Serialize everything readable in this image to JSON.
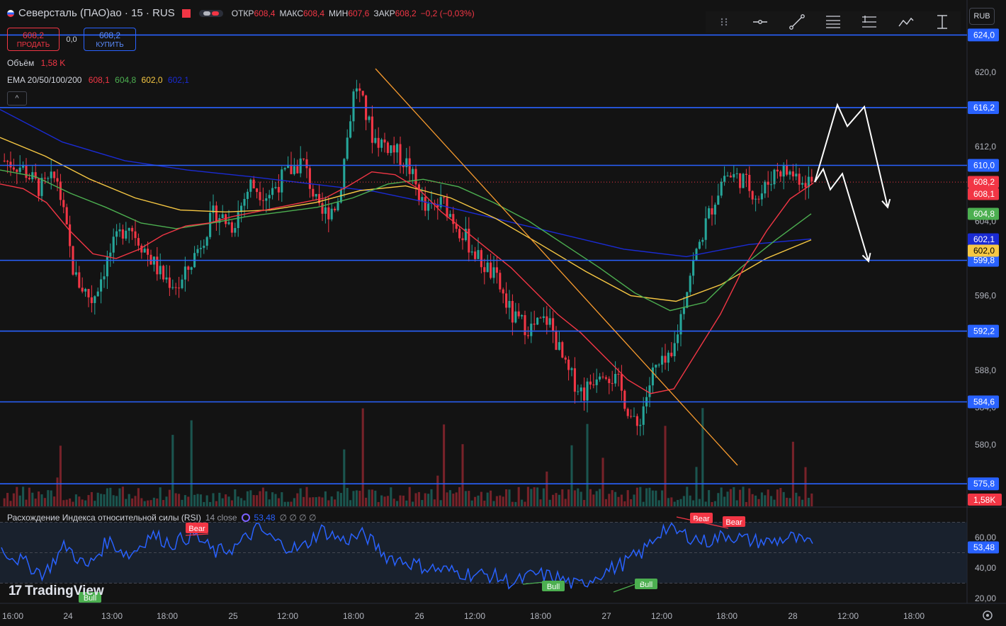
{
  "header": {
    "symbol": "Северсталь (ПАО)ао · 15 · RUS",
    "ohlc": [
      {
        "k": "ОТКР",
        "v": "608,4"
      },
      {
        "k": "МАКС",
        "v": "608,4"
      },
      {
        "k": "МИН",
        "v": "607,6"
      },
      {
        "k": "ЗАКР",
        "v": "608,2"
      },
      {
        "k": "",
        "v": "−0,2 (−0,03%)"
      }
    ]
  },
  "trade": {
    "sell_price": "608,2",
    "sell_label": "ПРОДАТЬ",
    "spread": "0,0",
    "buy_price": "608,2",
    "buy_label": "КУПИТЬ"
  },
  "volume_legend": {
    "label": "Объём",
    "value": "1,58 K"
  },
  "ema_legend": {
    "label": "EMA 20/50/100/200",
    "v20": "608,1",
    "v50": "604,8",
    "v100": "602,0",
    "v200": "602,1"
  },
  "collapse_label": "^",
  "currency": "RUB",
  "rsi_legend": {
    "label": "Расхождение Индекса относительной силы (RSI)",
    "params": "14 close",
    "value": "53,48",
    "extra": "∅ ∅ ∅ ∅"
  },
  "logo": {
    "text": "TradingView"
  },
  "colors": {
    "bull": "#26a69a",
    "bear": "#f23645",
    "ema20": "#f23645",
    "ema50": "#4caf50",
    "ema100": "#f7c843",
    "ema200": "#1a2bd4",
    "level": "#2962ff",
    "trend": "#f89b2e",
    "rsi": "#2962ff"
  },
  "chart_data": {
    "type": "candlestick",
    "x_ticks": [
      "16:00",
      "24",
      "13:00",
      "18:00",
      "25",
      "12:00",
      "18:00",
      "26",
      "12:00",
      "18:00",
      "27",
      "12:00",
      "18:00",
      "28",
      "12:00",
      "18:00"
    ],
    "y_ticks": [
      "620,0",
      "612,0",
      "596,0",
      "588,0",
      "580,0"
    ],
    "ylim": [
      575.0,
      626.0
    ],
    "horizontal_levels": [
      {
        "value": 624.0,
        "label": "624,0"
      },
      {
        "value": 616.2,
        "label": "616,2"
      },
      {
        "value": 610.0,
        "label": "610,0"
      },
      {
        "value": 599.8,
        "label": "599,8"
      },
      {
        "value": 592.2,
        "label": "592,2"
      },
      {
        "value": 584.6,
        "label": "584,6"
      },
      {
        "value": 575.8,
        "label": "575,8"
      }
    ],
    "price_labels": [
      {
        "value": 608.2,
        "label": "608,2",
        "color": "#f23645"
      },
      {
        "value": 608.1,
        "label": "608,1",
        "color": "#f23645"
      },
      {
        "value": 604.8,
        "label": "604,8",
        "color": "#4caf50"
      },
      {
        "value": 602.1,
        "label": "602,1",
        "color": "#1a2bd4"
      },
      {
        "value": 602.0,
        "label": "602,0",
        "color": "#f7c843"
      }
    ],
    "last_volume_label": "1,58K",
    "close_path": [
      610.5,
      609.8,
      607.5,
      608.7,
      598,
      595.5,
      600.5,
      604,
      601,
      598,
      597,
      601,
      605,
      603.5,
      608,
      606.8,
      609,
      610.5,
      604.5,
      606,
      619,
      613,
      612,
      610,
      605,
      606,
      603,
      600,
      597.8,
      593.5,
      592.5,
      593.5,
      588,
      585.5,
      588.5,
      586.5,
      581.5,
      588,
      589,
      598,
      604,
      609,
      608.6,
      606.5,
      609.7,
      609,
      608.2
    ],
    "ema20": [
      608,
      607.5,
      606,
      603,
      600.5,
      600,
      601,
      602.5,
      603.5,
      603.8,
      604.5,
      605,
      605.5,
      606,
      606.5,
      607.8,
      609.3,
      609,
      607.5,
      605,
      603,
      601,
      599,
      596.5,
      594,
      592,
      589.5,
      587,
      585.5,
      586,
      590,
      594,
      599,
      603,
      606.4,
      608.1
    ],
    "ema50": [
      609.5,
      608.8,
      607,
      605.5,
      603.8,
      603.2,
      603.8,
      604.5,
      605,
      605.5,
      606.5,
      608,
      608.5,
      607.7,
      606,
      604,
      601.5,
      599,
      596.3,
      594.4,
      595.3,
      599,
      602,
      604.8
    ],
    "ema100": [
      613,
      611,
      608.5,
      606.5,
      605.2,
      605,
      605.2,
      606,
      607.3,
      607.8,
      606.5,
      604.3,
      601.5,
      598.6,
      596,
      595.4,
      597.2,
      600,
      602
    ],
    "ema200": [
      616,
      612.5,
      610.5,
      609.5,
      608.8,
      608,
      607.2,
      605.8,
      604.2,
      602.6,
      601,
      600.2,
      601.5,
      602.1
    ],
    "trend_line": {
      "from": [
        621,
        620.5
      ],
      "to": [
        1041,
        581.2
      ]
    },
    "projection_paths": [
      [
        [
          1150,
          608.2
        ],
        [
          1182,
          616.5
        ],
        [
          1196,
          614.2
        ],
        [
          1220,
          616.3
        ],
        [
          1253,
          605.5
        ]
      ],
      [
        [
          1150,
          608.2
        ],
        [
          1162,
          609.6
        ],
        [
          1172,
          607.4
        ],
        [
          1189,
          609.1
        ],
        [
          1226,
          599.7
        ]
      ]
    ],
    "rsi": {
      "y_ticks": [
        "60,00",
        "53,48",
        "40,00",
        "20,00"
      ],
      "ylim": [
        18,
        72
      ],
      "band": [
        30,
        70
      ],
      "current": 53.48,
      "divergence_labels": [
        {
          "text": "Bear",
          "kind": "bear"
        },
        {
          "text": "Bull",
          "kind": "bull"
        },
        {
          "text": "Bull",
          "kind": "bull"
        },
        {
          "text": "Bull",
          "kind": "bull"
        },
        {
          "text": "Bear",
          "kind": "bear"
        },
        {
          "text": "Bear",
          "kind": "bear"
        }
      ]
    }
  }
}
